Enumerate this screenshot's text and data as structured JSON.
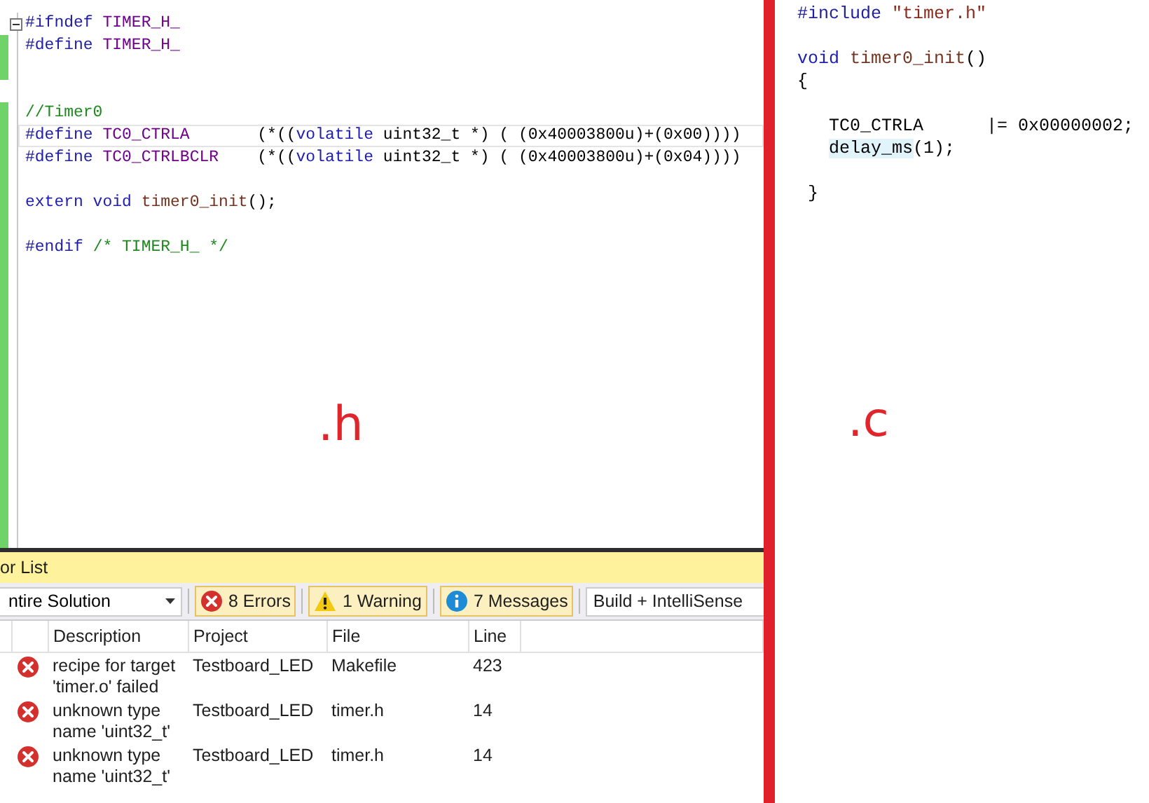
{
  "header_file": {
    "annotation": ".h",
    "lines": [
      {
        "kind": "code",
        "foldable": true,
        "changed": false,
        "current": false,
        "tokens": [
          {
            "kind": "directive",
            "text": "#ifndef "
          },
          {
            "kind": "macro",
            "text": "TIMER_H_"
          }
        ]
      },
      {
        "kind": "code",
        "foldable": false,
        "changed": true,
        "current": false,
        "tokens": [
          {
            "kind": "directive",
            "text": "#define "
          },
          {
            "kind": "macro",
            "text": "TIMER_H_"
          }
        ]
      },
      {
        "kind": "blank",
        "foldable": false,
        "changed": true,
        "current": false
      },
      {
        "kind": "blank",
        "foldable": false,
        "changed": false,
        "current": false
      },
      {
        "kind": "code",
        "foldable": false,
        "changed": true,
        "current": false,
        "tokens": [
          {
            "kind": "comment",
            "text": "//Timer0"
          }
        ]
      },
      {
        "kind": "code",
        "foldable": false,
        "changed": true,
        "current": true,
        "tokens": [
          {
            "kind": "directive",
            "text": "#define "
          },
          {
            "kind": "macro",
            "text": "TC0_CTRLA"
          },
          {
            "kind": "plain",
            "text": "       (*(("
          },
          {
            "kind": "keyword",
            "text": "volatile"
          },
          {
            "kind": "plain",
            "text": " uint32_t *) ( (0x40003800u)+(0x00))))"
          }
        ]
      },
      {
        "kind": "code",
        "foldable": false,
        "changed": true,
        "current": false,
        "tokens": [
          {
            "kind": "directive",
            "text": "#define "
          },
          {
            "kind": "macro",
            "text": "TC0_CTRLBCLR"
          },
          {
            "kind": "plain",
            "text": "    (*(("
          },
          {
            "kind": "keyword",
            "text": "volatile"
          },
          {
            "kind": "plain",
            "text": " uint32_t *) ( (0x40003800u)+(0x04))))"
          }
        ]
      },
      {
        "kind": "blank",
        "foldable": false,
        "changed": true,
        "current": false
      },
      {
        "kind": "code",
        "foldable": false,
        "changed": true,
        "current": false,
        "tokens": [
          {
            "kind": "keyword",
            "text": "extern void "
          },
          {
            "kind": "function",
            "text": "timer0_init"
          },
          {
            "kind": "plain",
            "text": "();"
          }
        ]
      },
      {
        "kind": "blank",
        "foldable": false,
        "changed": true,
        "current": false
      },
      {
        "kind": "code",
        "foldable": false,
        "changed": true,
        "current": false,
        "tokens": [
          {
            "kind": "directive",
            "text": "#endif "
          },
          {
            "kind": "comment",
            "text": "/* TIMER_H_ */"
          }
        ]
      }
    ]
  },
  "error_list": {
    "title": "or List",
    "scope": "ntire Solution",
    "filters": [
      {
        "kind": "error",
        "label": "8 Errors",
        "selected": true
      },
      {
        "kind": "warning",
        "label": "1 Warning",
        "selected": true
      },
      {
        "kind": "message",
        "label": "7 Messages",
        "selected": true
      }
    ],
    "source_filter": "Build + IntelliSense",
    "columns": [
      "Description",
      "Project",
      "File",
      "Line"
    ],
    "rows": [
      {
        "kind": "error",
        "description": "recipe for target 'timer.o' failed",
        "project": "Testboard_LED",
        "file": "Makefile",
        "line": "423"
      },
      {
        "kind": "error",
        "description": "unknown type name 'uint32_t'",
        "project": "Testboard_LED",
        "file": "timer.h",
        "line": "14"
      },
      {
        "kind": "error",
        "description": "unknown type name 'uint32_t'",
        "project": "Testboard_LED",
        "file": "timer.h",
        "line": "14"
      }
    ]
  },
  "source_file": {
    "annotation": ".c",
    "lines": [
      {
        "kind": "code",
        "tokens": [
          {
            "kind": "directive",
            "text": "#include "
          },
          {
            "kind": "string",
            "text": "\"timer.h\""
          }
        ]
      },
      {
        "kind": "blank"
      },
      {
        "kind": "code",
        "tokens": [
          {
            "kind": "keyword",
            "text": "void "
          },
          {
            "kind": "function",
            "text": "timer0_init"
          },
          {
            "kind": "plain",
            "text": "()"
          }
        ]
      },
      {
        "kind": "code",
        "tokens": [
          {
            "kind": "plain",
            "text": "{"
          }
        ]
      },
      {
        "kind": "blank"
      },
      {
        "kind": "code",
        "tokens": [
          {
            "kind": "plain",
            "text": "   TC0_CTRLA      |= 0x00000002;"
          }
        ]
      },
      {
        "kind": "code",
        "tokens": [
          {
            "kind": "highlight",
            "text": "   delay_ms"
          },
          {
            "kind": "plain",
            "text": "(1);"
          }
        ]
      },
      {
        "kind": "blank"
      },
      {
        "kind": "code",
        "tokens": [
          {
            "kind": "plain",
            "text": " }"
          }
        ]
      }
    ]
  }
}
